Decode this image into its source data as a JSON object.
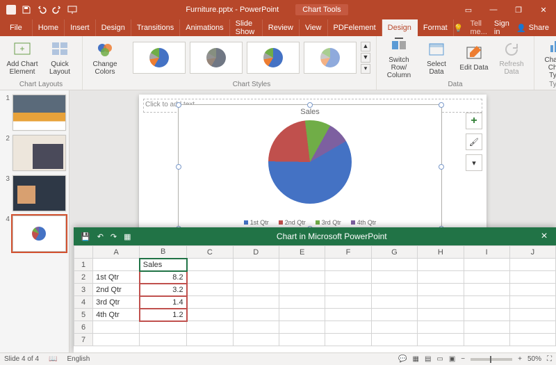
{
  "app": {
    "doc_title": "Furniture.pptx - PowerPoint",
    "context_group": "Chart Tools"
  },
  "tabs": {
    "file": "File",
    "items": [
      "Home",
      "Insert",
      "Design",
      "Transitions",
      "Animations",
      "Slide Show",
      "Review",
      "View",
      "PDFelement",
      "Design",
      "Format"
    ],
    "active_index": 9,
    "tell_me": "Tell me...",
    "sign_in": "Sign in",
    "share": "Share"
  },
  "ribbon": {
    "add_chart_element": "Add Chart Element",
    "quick_layout": "Quick Layout",
    "change_colors": "Change Colors",
    "group_layouts": "Chart Layouts",
    "group_styles": "Chart Styles",
    "switch_row_column": "Switch Row/ Column",
    "select_data": "Select Data",
    "edit_data": "Edit Data",
    "refresh_data": "Refresh Data",
    "group_data": "Data",
    "change_chart_type": "Change Chart Type",
    "group_type": "Type"
  },
  "slides": {
    "count": 4,
    "selected": 4
  },
  "placeholder_text": "Click to add text",
  "chart_data": {
    "type": "pie",
    "title": "Sales",
    "categories": [
      "1st Qtr",
      "2nd Qtr",
      "3rd Qtr",
      "4th Qtr"
    ],
    "values": [
      8.2,
      3.2,
      1.4,
      1.2
    ],
    "colors": [
      "#4472c4",
      "#c0504d",
      "#70ad47",
      "#7d60a0"
    ],
    "legend_position": "bottom"
  },
  "excel": {
    "title": "Chart in Microsoft PowerPoint",
    "columns": [
      "A",
      "B",
      "C",
      "D",
      "E",
      "F",
      "G",
      "H",
      "I",
      "J"
    ],
    "header_row": [
      "",
      "Sales"
    ],
    "rows": [
      {
        "n": 2,
        "a": "1st Qtr",
        "b": "8.2"
      },
      {
        "n": 3,
        "a": "2nd Qtr",
        "b": "3.2"
      },
      {
        "n": 4,
        "a": "3rd Qtr",
        "b": "1.4"
      },
      {
        "n": 5,
        "a": "4th Qtr",
        "b": "1.2"
      },
      {
        "n": 6,
        "a": "",
        "b": ""
      },
      {
        "n": 7,
        "a": "",
        "b": ""
      }
    ],
    "selected_cell_ref": "B1"
  },
  "status": {
    "slide_of": "Slide 4 of 4",
    "language": "English",
    "zoom": "50%"
  }
}
